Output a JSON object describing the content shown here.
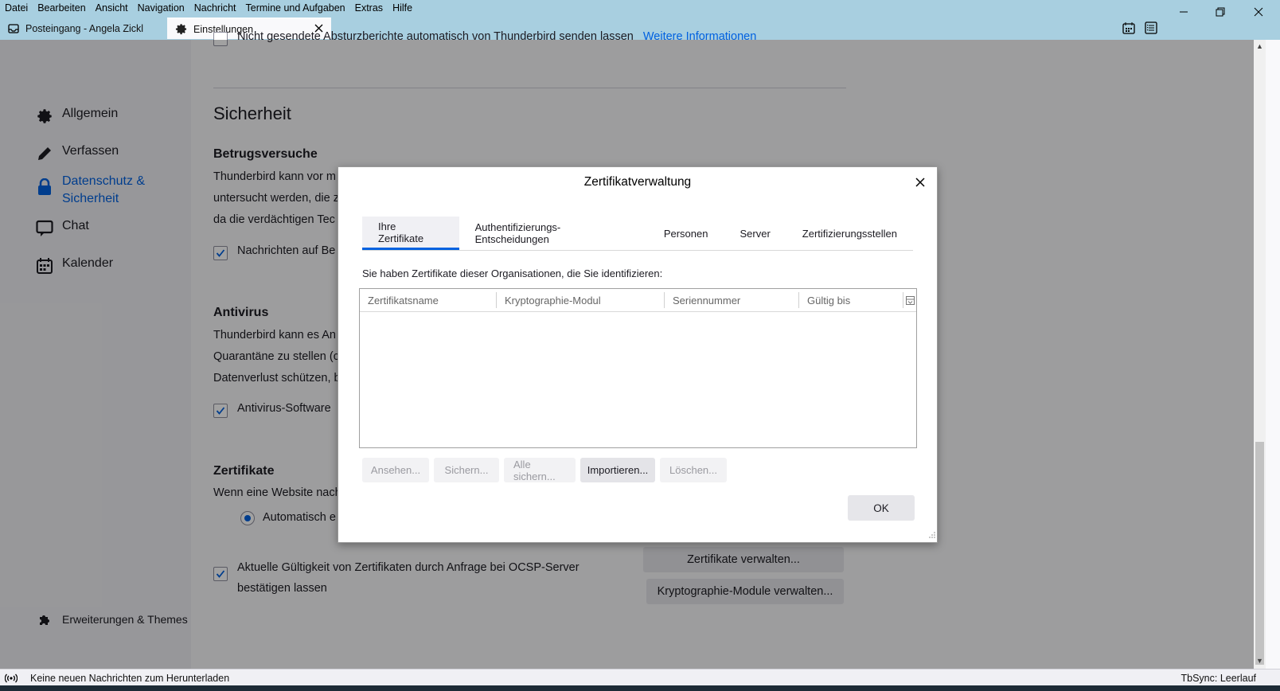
{
  "menubar": [
    "Datei",
    "Bearbeiten",
    "Ansicht",
    "Navigation",
    "Nachricht",
    "Termine und Aufgaben",
    "Extras",
    "Hilfe"
  ],
  "tabs": {
    "inbox": "Posteingang - Angela Zickl",
    "settings": "Einstellungen"
  },
  "sidebar": {
    "items": [
      "Allgemein",
      "Verfassen",
      "Datenschutz &",
      "Sicherheit",
      "Chat",
      "Kalender"
    ],
    "extensions": "Erweiterungen & Themes"
  },
  "background": {
    "top_text": "Nicht gesendete Absturzberichte automatisch von Thunderbird senden lassen",
    "top_link": "Weitere Informationen",
    "section_title": "Sicherheit",
    "fraud_heading": "Betrugsversuche",
    "fraud_lines": [
      "Thunderbird kann vor m",
      "untersucht werden, die z",
      "da die verdächtigen Tec"
    ],
    "fraud_checkbox": "Nachrichten auf Be",
    "antivirus_heading": "Antivirus",
    "antivirus_lines": [
      "Thunderbird kann es An",
      "Quarantäne zu stellen (c",
      "Datenverlust schützen, b"
    ],
    "antivirus_checkbox": "Antivirus-Software",
    "cert_heading": "Zertifikate",
    "cert_line": "Wenn eine Website nach",
    "cert_radio": "Automatisch e",
    "ocsp_line1": "Aktuelle Gültigkeit von Zertifikaten durch Anfrage bei OCSP-Server",
    "ocsp_line2": "bestätigen lassen",
    "manage_certs_button": "Zertifikate verwalten...",
    "manage_crypto_button": "Kryptographie-Module verwalten..."
  },
  "dialog": {
    "title": "Zertifikatverwaltung",
    "tabs": [
      "Ihre Zertifikate",
      "Authentifizierungs-Entscheidungen",
      "Personen",
      "Server",
      "Zertifizierungsstellen"
    ],
    "description": "Sie haben Zertifikate dieser Organisationen, die Sie identifizieren:",
    "columns": [
      "Zertifikatsname",
      "Kryptographie-Modul",
      "Seriennummer",
      "Gültig bis"
    ],
    "buttons": [
      "Ansehen...",
      "Sichern...",
      "Alle sichern...",
      "Importieren...",
      "Löschen..."
    ],
    "ok": "OK"
  },
  "statusbar": {
    "message": "Keine neuen Nachrichten zum Herunterladen",
    "tbsync": "TbSync: Leerlauf"
  },
  "colors": {
    "titlebar": "#a8cfe0",
    "accent": "#0061e0"
  }
}
